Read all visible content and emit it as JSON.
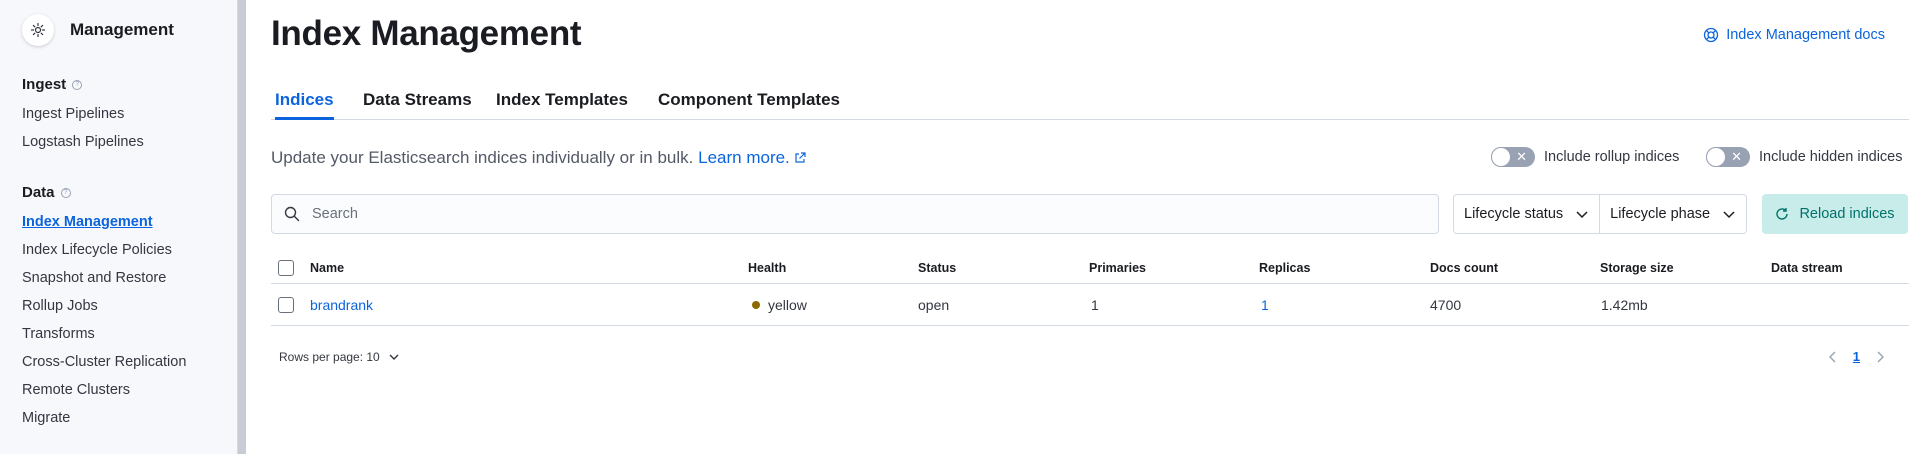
{
  "sidebar": {
    "title": "Management",
    "groups": [
      {
        "label": "Ingest",
        "items": [
          "Ingest Pipelines",
          "Logstash Pipelines"
        ]
      },
      {
        "label": "Data",
        "items": [
          "Index Management",
          "Index Lifecycle Policies",
          "Snapshot and Restore",
          "Rollup Jobs",
          "Transforms",
          "Cross-Cluster Replication",
          "Remote Clusters",
          "Migrate"
        ]
      }
    ],
    "active_item": "Index Management"
  },
  "header": {
    "title": "Index Management",
    "docs_link": "Index Management docs"
  },
  "tabs": [
    {
      "label": "Indices",
      "active": true
    },
    {
      "label": "Data Streams",
      "active": false
    },
    {
      "label": "Index Templates",
      "active": false
    },
    {
      "label": "Component Templates",
      "active": false
    }
  ],
  "description": {
    "text": "Update your Elasticsearch indices individually or in bulk.",
    "learn_more": "Learn more."
  },
  "toggles": {
    "rollup": {
      "label": "Include rollup indices",
      "on": false
    },
    "hidden": {
      "label": "Include hidden indices",
      "on": false
    }
  },
  "search": {
    "placeholder": "Search",
    "value": ""
  },
  "filters": {
    "lifecycle_status": "Lifecycle status",
    "lifecycle_phase": "Lifecycle phase"
  },
  "reload_button": "Reload indices",
  "table": {
    "columns": [
      "Name",
      "Health",
      "Status",
      "Primaries",
      "Replicas",
      "Docs count",
      "Storage size",
      "Data stream"
    ],
    "rows": [
      {
        "name": "brandrank",
        "health": "yellow",
        "status": "open",
        "primaries": "1",
        "replicas": "1",
        "docs_count": "4700",
        "storage_size": "1.42mb",
        "data_stream": ""
      }
    ]
  },
  "pagination": {
    "rows_per_page": "Rows per page: 10",
    "current_page": "1"
  },
  "colors": {
    "accent": "#0b64dd",
    "health_yellow": "#8b6a00",
    "reload_bg": "#c7ece9",
    "reload_text": "#00726b"
  }
}
